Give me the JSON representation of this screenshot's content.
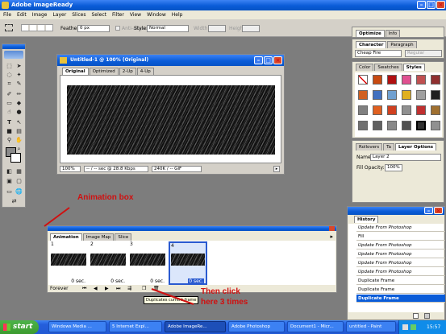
{
  "window": {
    "title": "Adobe ImageReady"
  },
  "menu": [
    "File",
    "Edit",
    "Image",
    "Layer",
    "Slices",
    "Select",
    "Filter",
    "View",
    "Window",
    "Help"
  ],
  "options": {
    "feather_label": "Feather:",
    "feather_value": "0 px",
    "anti_aliased": "Anti-aliased",
    "style_label": "Style:",
    "style_value": "Normal",
    "width_label": "Width:",
    "height_label": "Height:"
  },
  "doc": {
    "title": "Untitled-1 @ 100% (Original)",
    "tabs": [
      "Original",
      "Optimized",
      "2-Up",
      "4-Up"
    ],
    "zoom": "100%",
    "status": "-- / -- sec @ 28.8 Kbps",
    "info": "240K / -- GIF"
  },
  "optimize_panel": {
    "tabs": [
      "Optimize",
      "Info"
    ]
  },
  "char_panel": {
    "tabs": [
      "Character",
      "Paragraph"
    ],
    "font": "Cheap Fire",
    "style": "Regular"
  },
  "styles_panel": {
    "tabs": [
      "Color",
      "Swatches",
      "Styles"
    ]
  },
  "layer_options": {
    "tabs": [
      "Rollovers",
      "Ta",
      "Layer Options"
    ],
    "name_label": "Name:",
    "name_value": "Layer 2",
    "fill_label": "Fill Opacity:",
    "fill_value": "100%"
  },
  "history": {
    "title": "History",
    "items": [
      "Update From Photoshop",
      "Fill",
      "Update From Photoshop",
      "Update From Photoshop",
      "Update From Photoshop",
      "Update From Photoshop",
      "Duplicate Frame",
      "Duplicate Frame",
      "Duplicate Frame"
    ],
    "selected_index": 8
  },
  "animation": {
    "tabs": [
      "Animation",
      "Image Map",
      "Slice"
    ],
    "frames": [
      {
        "num": "1",
        "delay": "0 sec."
      },
      {
        "num": "2",
        "delay": "0 sec."
      },
      {
        "num": "3",
        "delay": "0 sec."
      },
      {
        "num": "4",
        "delay": "0 sec."
      }
    ],
    "selected_frame": 3,
    "loop": "Forever",
    "tooltip": "Duplicates current frame"
  },
  "annotations": {
    "anim_box": "Animation box",
    "then_click_1": "Then click",
    "then_click_2": "here 3 times"
  },
  "taskbar": {
    "start": "start",
    "tasks": [
      "Windows Media ...",
      "5 Internet Expl...",
      "Adobe ImageRe...",
      "Adobe Photoshop",
      "Document1 - Micr...",
      "untitled - Paint"
    ],
    "clock": "15:57"
  },
  "colors": {
    "xp_blue": "#0a5cd8",
    "annotation_red": "#d01010",
    "start_green": "#3c9a2e"
  }
}
